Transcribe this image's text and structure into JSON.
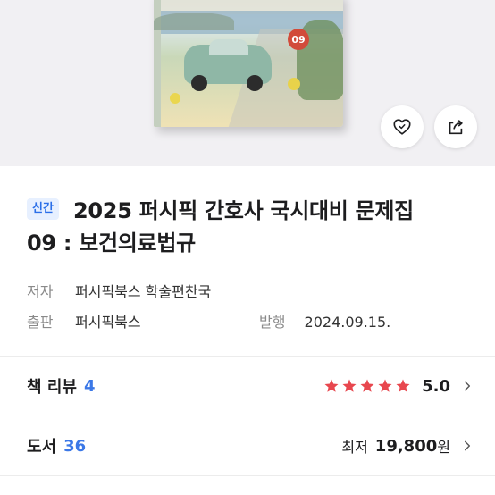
{
  "cover": {
    "volume_badge": "09"
  },
  "actions": {
    "like_icon": "heart-icon",
    "share_icon": "share-icon"
  },
  "product": {
    "badge": "신간",
    "title_line1": "2025 퍼시픽 간호사 국시대비 문제집",
    "title_line2": "09 : 보건의료법규"
  },
  "meta": {
    "author_label": "저자",
    "author_value": "퍼시픽북스 학술편찬국",
    "publisher_label": "출판",
    "publisher_value": "퍼시픽북스",
    "date_label": "발행",
    "date_value": "2024.09.15."
  },
  "review": {
    "label": "책 리뷰",
    "count": "4",
    "rating": "5.0",
    "stars": 5
  },
  "books": {
    "label": "도서",
    "count": "36",
    "lowest_label": "최저",
    "price": "19,800",
    "unit": "원"
  },
  "colors": {
    "accent": "#3b78e7",
    "star": "#e8474e",
    "badge_bg": "#e7f0ff"
  }
}
